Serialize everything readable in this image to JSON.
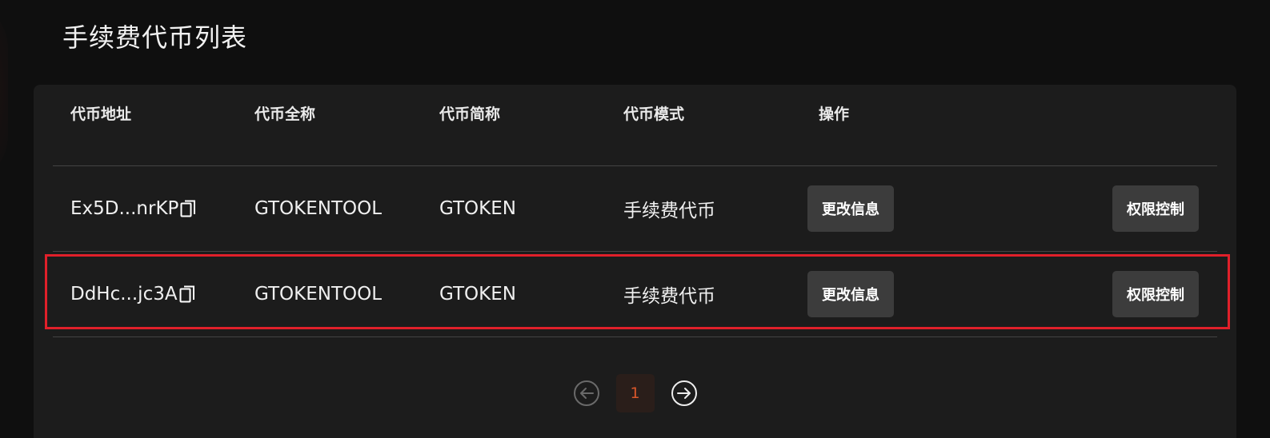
{
  "page": {
    "title": "手续费代币列表"
  },
  "table": {
    "headers": [
      "代币地址",
      "代币全称",
      "代币简称",
      "代币模式",
      "操作"
    ],
    "rows": [
      {
        "address": "Ex5D...nrKP",
        "full_name": "GTOKENTOOL",
        "symbol": "GTOKEN",
        "mode": "手续费代币",
        "edit_label": "更改信息",
        "perm_label": "权限控制"
      },
      {
        "address": "DdHc...jc3A",
        "full_name": "GTOKENTOOL",
        "symbol": "GTOKEN",
        "mode": "手续费代币",
        "edit_label": "更改信息",
        "perm_label": "权限控制"
      }
    ]
  },
  "pagination": {
    "current_page": "1",
    "prev_icon": "arrow-left-circle-icon",
    "next_icon": "arrow-right-circle-icon"
  },
  "colors": {
    "accent": "#d8562a",
    "highlight_border": "#e0202a",
    "panel_bg": "#1c1c1c",
    "button_bg": "#3c3c3c"
  },
  "icons": {
    "copy": "copy-icon"
  }
}
